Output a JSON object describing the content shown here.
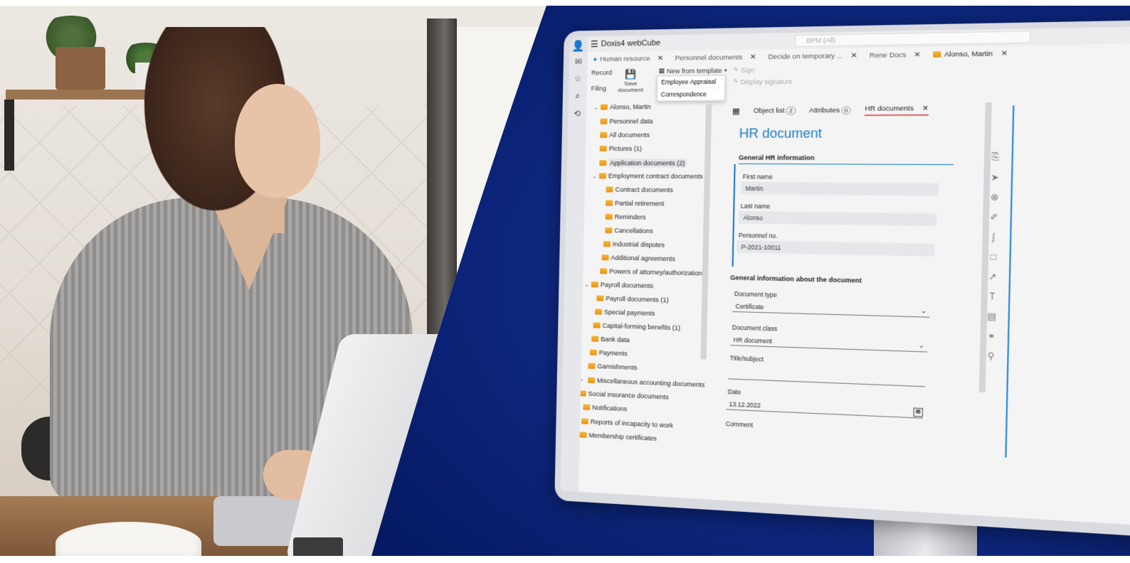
{
  "app": {
    "title": "Doxis4 webCube",
    "search_placeholder": "BPM (All)"
  },
  "tabs": [
    {
      "label": "Human resource"
    },
    {
      "label": "Personnel documents"
    },
    {
      "label": "Decide on temporary ..."
    },
    {
      "label": "Rene Docs"
    },
    {
      "label": "Alonso, Martin"
    }
  ],
  "ribbon": {
    "record": "Record",
    "filing": "Filing",
    "save_line1": "Save",
    "save_line2": "document",
    "new_from_template": "New from template",
    "sign": "Sign",
    "display_signature": "Display signature",
    "template_menu": [
      "Employee Appraisal",
      "Correspondence"
    ]
  },
  "tree": {
    "root": "Alonso, Martin",
    "items": [
      "Personnel data",
      "All documents",
      "Pictures (1)",
      "Application documents (2)",
      "Employment contract documents",
      "Contract documents",
      "Partial retirement",
      "Reminders",
      "Cancellations",
      "Industrial disputes",
      "Additional agreements",
      "Powers of attorney/authorizations",
      "Payroll documents",
      "Payroll documents (1)",
      "Special payments",
      "Capital-forming benefits (1)",
      "Bank data",
      "Payments",
      "Garnishments",
      "Miscellaneous accounting documents",
      "Social insurance documents",
      "Notifications",
      "Reports of incapacity to work",
      "Membership certificates"
    ]
  },
  "main_tabs": {
    "object_list": "Object list",
    "object_list_count": "2",
    "attributes": "Attributes",
    "attributes_count": "0",
    "hr_documents": "HR documents"
  },
  "form": {
    "title": "HR document",
    "section1": "General HR information",
    "first_name_label": "First name",
    "first_name": "Martin",
    "last_name_label": "Last name",
    "last_name": "Alonso",
    "personnel_no_label": "Personnel no.",
    "personnel_no": "P-2021-10011",
    "section2": "General information about the document",
    "document_type_label": "Document type",
    "document_type": "Certificate",
    "document_class_label": "Document class",
    "document_class": "HR document",
    "title_subject_label": "Title/subject",
    "date_label": "Date",
    "date": "13.12.2022",
    "comment_label": "Comment"
  },
  "colors": {
    "accent": "#1c7fc2",
    "background": "#0f2a86",
    "folder": "#f7b733"
  }
}
